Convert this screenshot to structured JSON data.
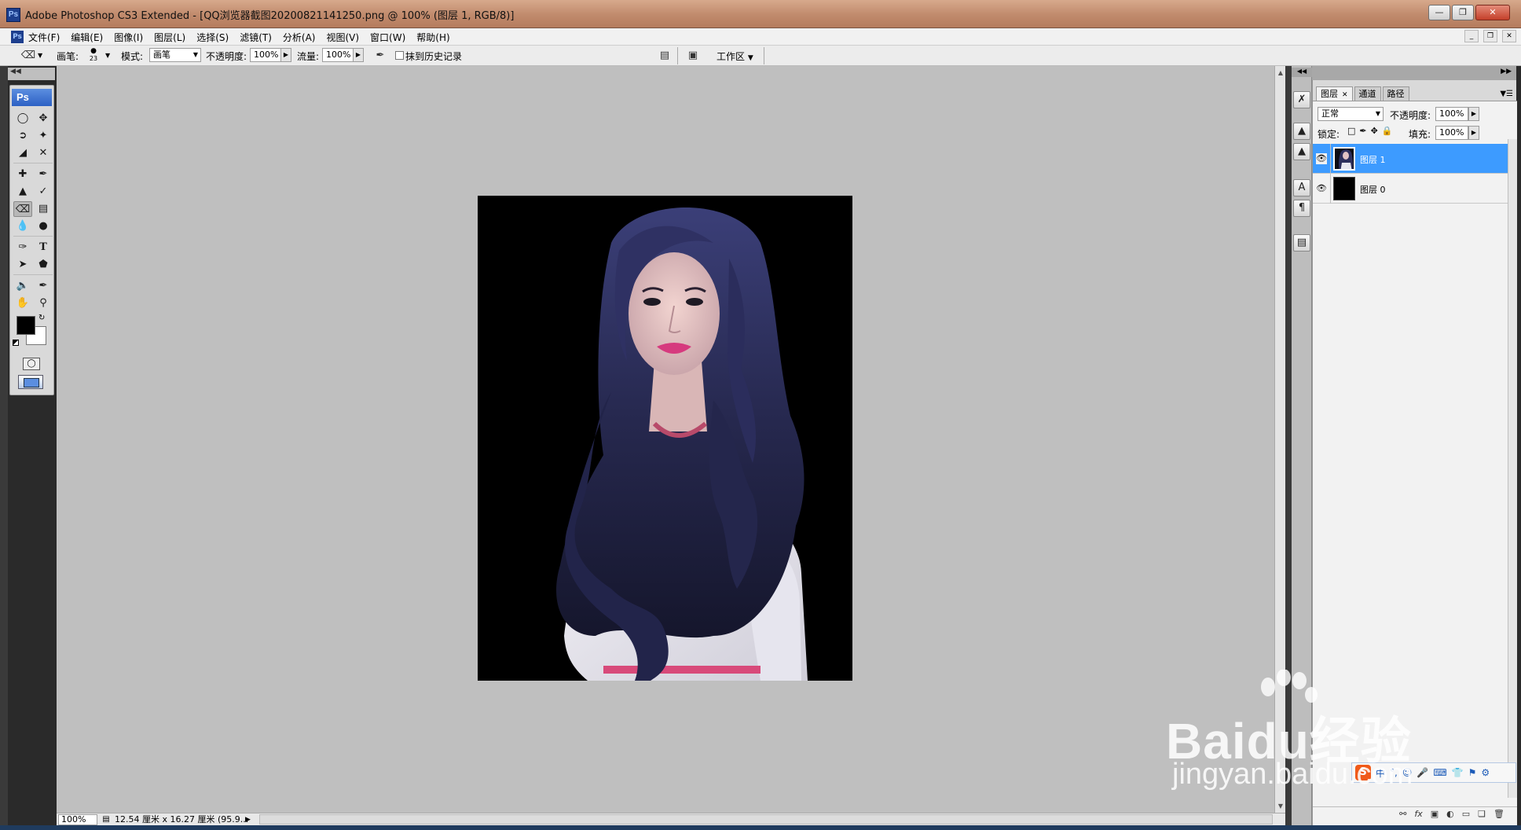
{
  "window": {
    "title": "Adobe Photoshop CS3 Extended - [QQ浏览器截图20200821141250.png @ 100% (图层 1, RGB/8)]",
    "app_icon": "Ps",
    "controls": [
      "minimize-icon",
      "maximize-icon",
      "close-icon"
    ]
  },
  "menubar": {
    "icon": "Ps",
    "items": [
      "文件(F)",
      "编辑(E)",
      "图像(I)",
      "图层(L)",
      "选择(S)",
      "滤镜(T)",
      "分析(A)",
      "视图(V)",
      "窗口(W)",
      "帮助(H)"
    ]
  },
  "options": {
    "brush_label": "画笔:",
    "brush_size": "23",
    "mode_label": "模式:",
    "mode_value": "画笔",
    "opacity_label": "不透明度:",
    "opacity_value": "100%",
    "flow_label": "流量:",
    "flow_value": "100%",
    "erase_history_label": "抹到历史记录",
    "erase_history_checked": false,
    "workspace_label": "工作区"
  },
  "toolbox": {
    "logo": "Ps",
    "active_tool": "eraser",
    "foreground_color": "#000000",
    "background_color": "#ffffff"
  },
  "document": {
    "background_color": "#000000",
    "subject": "portrait-cutout"
  },
  "status": {
    "zoom": "100%",
    "info": "12.54 厘米 x 16.27 厘米 (95.9..."
  },
  "layers_panel": {
    "tabs": [
      "图层",
      "通道",
      "路径"
    ],
    "active_tab": 0,
    "blend_mode": "正常",
    "opacity_label": "不透明度:",
    "opacity_value": "100%",
    "lock_label": "锁定:",
    "fill_label": "填充:",
    "fill_value": "100%",
    "layers": [
      {
        "name": "图层 1",
        "visible": true,
        "selected": true
      },
      {
        "name": "图层 0",
        "visible": true,
        "selected": false
      }
    ]
  },
  "watermark": {
    "brand": "Baidu经验",
    "url": "jingyan.baidu.com"
  },
  "ime": {
    "logo": "S",
    "items": [
      "中",
      "°,",
      "☺",
      "🎤",
      "⌨",
      "👕",
      "⚑",
      "⚙"
    ]
  },
  "colors": {
    "selected_layer": "#3d9bff",
    "canvas_bg": "#bfbfbf",
    "panel_bg": "#d9d9d9"
  }
}
